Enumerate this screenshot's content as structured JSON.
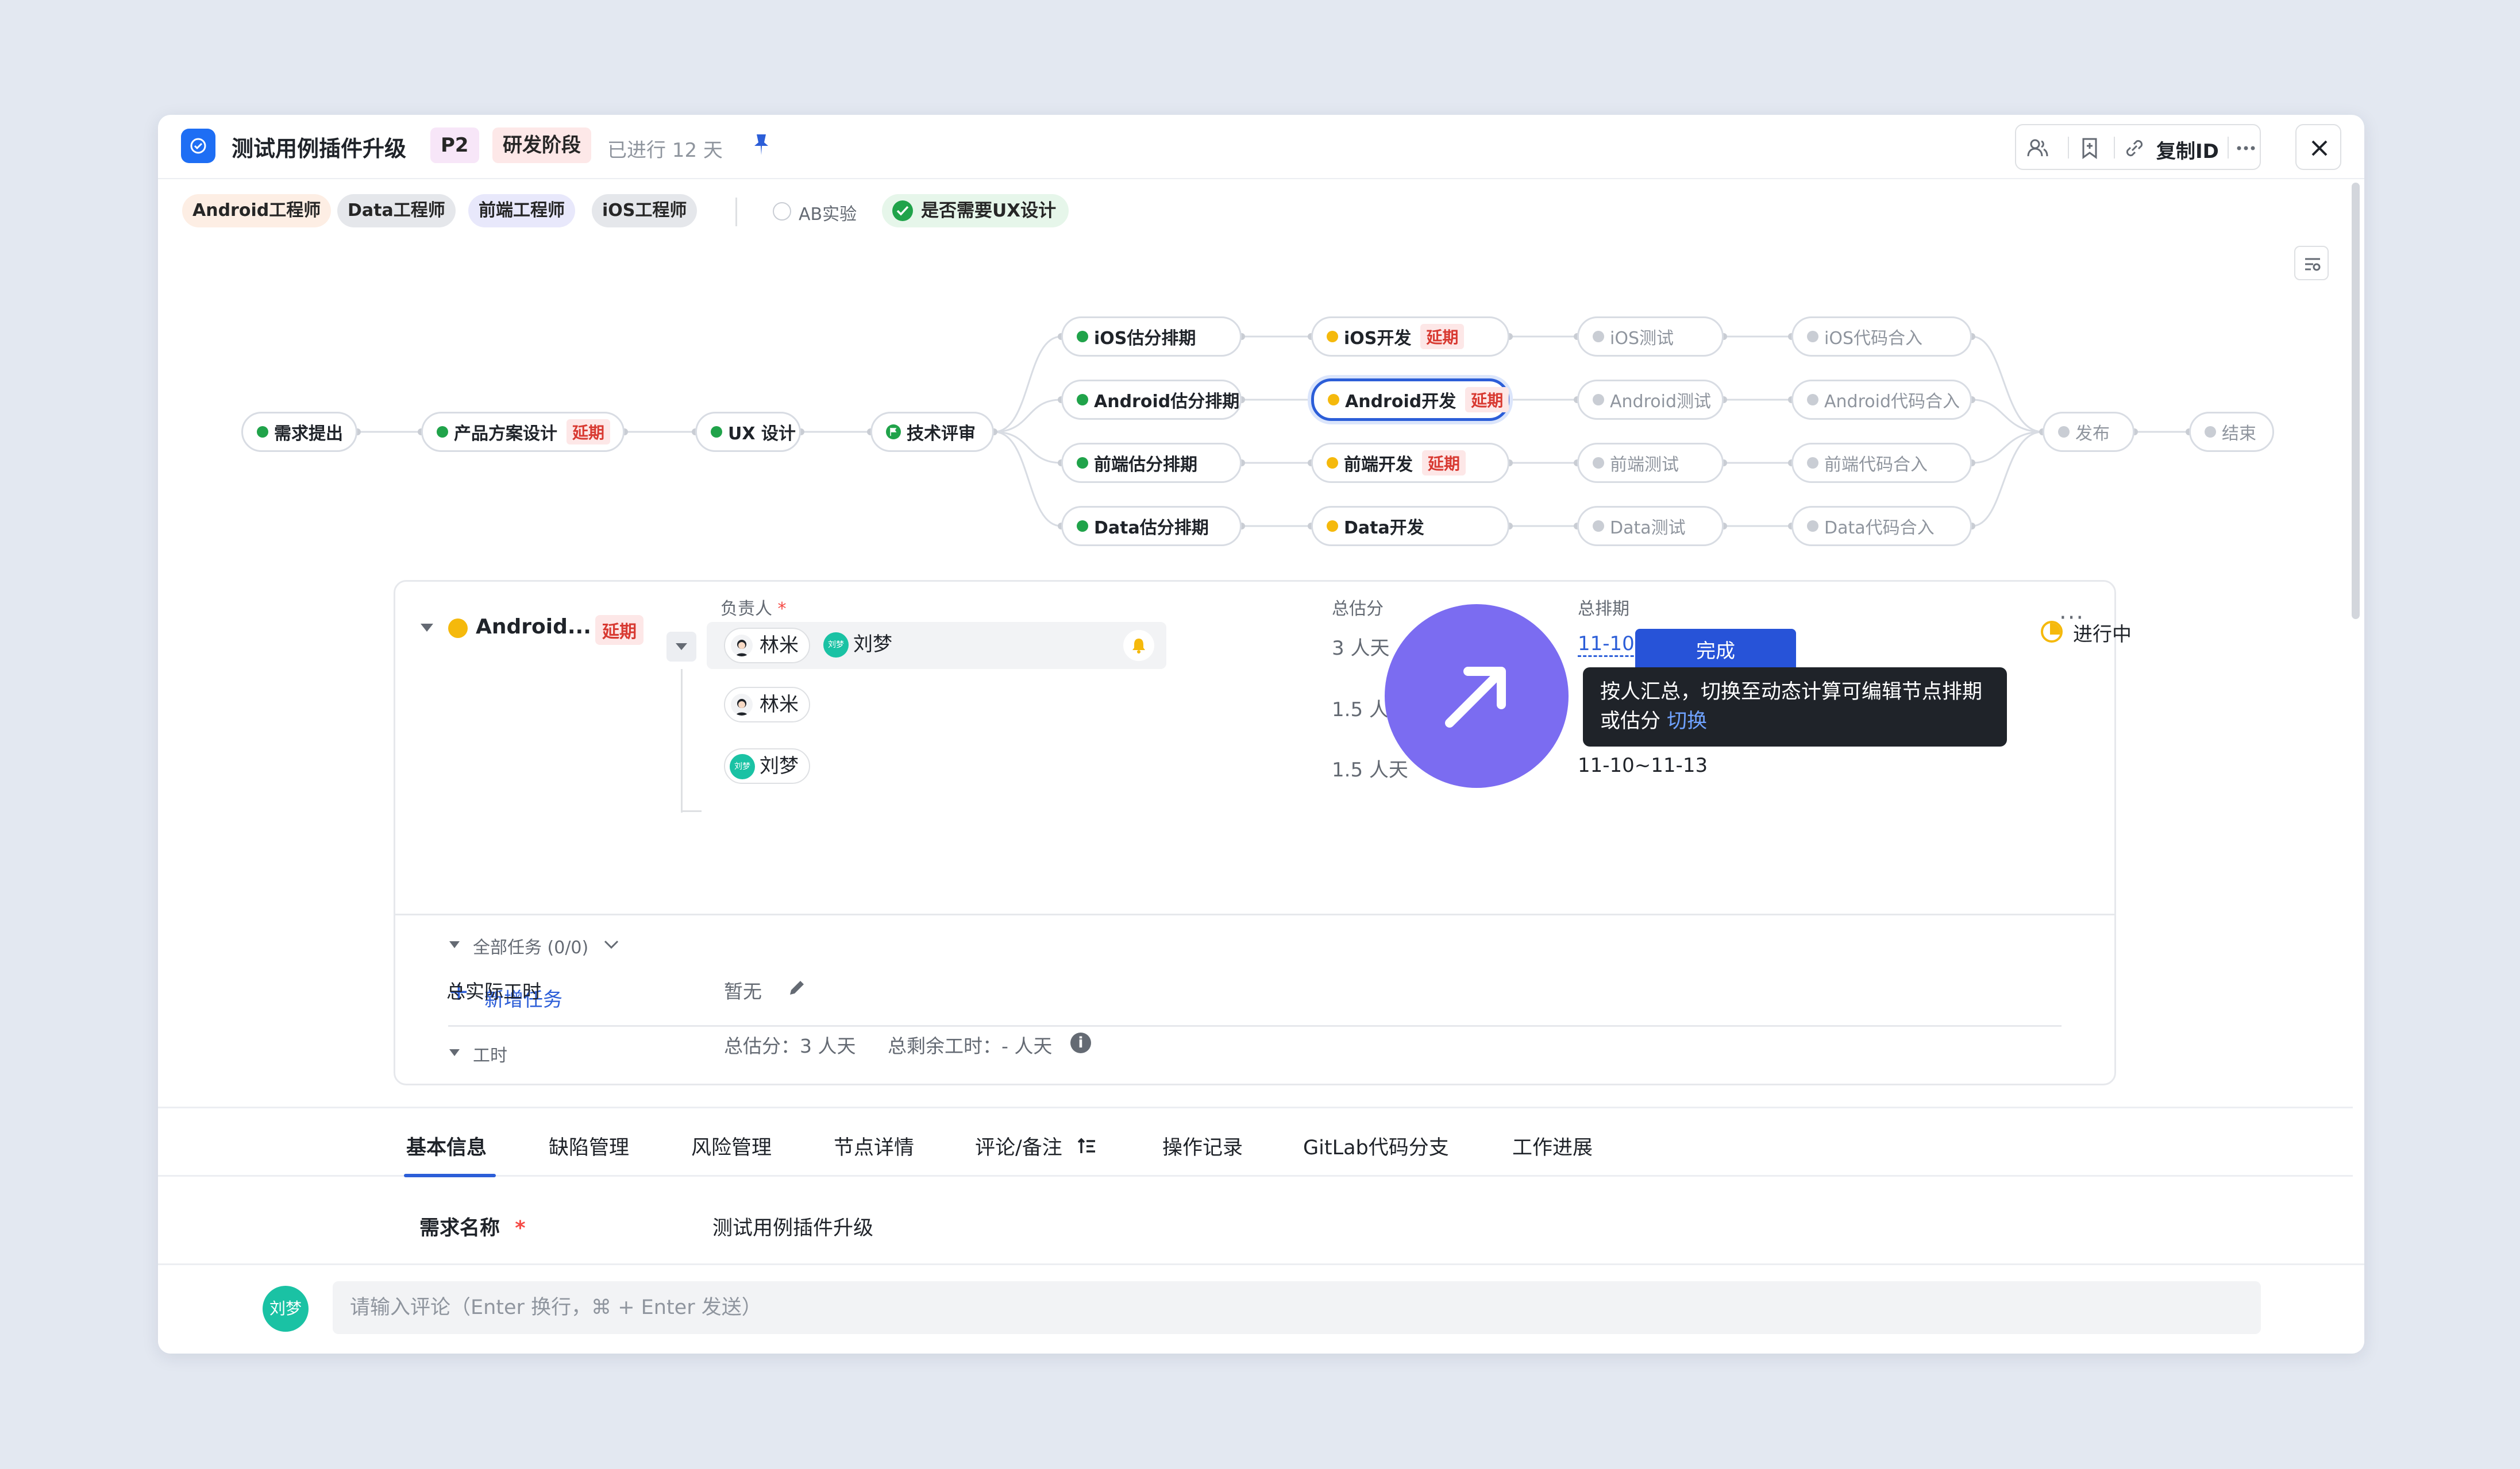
{
  "header": {
    "title": "测试用例插件升级",
    "priority": "P2",
    "stage": "研发阶段",
    "elapsed": "已进行 12 天",
    "copy_id_label": "复制ID"
  },
  "roles": [
    "Android工程师",
    "Data工程师",
    "前端工程师",
    "iOS工程师"
  ],
  "role_colors": [
    "#fdeee4",
    "#e5e7eb",
    "#e8e8fb",
    "#e5e7eb"
  ],
  "toggles": {
    "ab_label": "AB实验",
    "ux_label": "是否需要UX设计"
  },
  "flow": {
    "nodes": {
      "req": "需求提出",
      "product": "产品方案设计",
      "ux": "UX 设计",
      "review": "技术评审",
      "ios_est": "iOS估分排期",
      "android_est": "Android估分排期",
      "fe_est": "前端估分排期",
      "data_est": "Data估分排期",
      "ios_dev": "iOS开发",
      "android_dev": "Android开发",
      "fe_dev": "前端开发",
      "data_dev": "Data开发",
      "ios_test": "iOS测试",
      "android_test": "Android测试",
      "fe_test": "前端测试",
      "data_test": "Data测试",
      "ios_merge": "iOS代码合入",
      "android_merge": "Android代码合入",
      "fe_merge": "前端代码合入",
      "data_merge": "Data代码合入",
      "release": "发布",
      "end": "结束"
    },
    "delay_label": "延期"
  },
  "detail": {
    "node_name": "Android...",
    "delay_label": "延期",
    "col_owner": "负责人",
    "required_mark": "*",
    "col_estimate": "总估分",
    "col_schedule": "总排期",
    "owners": [
      "林米",
      "刘梦"
    ],
    "avatar_text": "刘梦",
    "total_estimate": "3 人天",
    "rows": [
      {
        "owner": "林米",
        "estimate": "1.5 人天",
        "schedule": ""
      },
      {
        "owner": "刘梦",
        "estimate": "1.5 人天",
        "schedule": "11-10~11-13"
      }
    ],
    "total_schedule": "11-10~11-13",
    "status": "进行中",
    "done_button": "完成",
    "all_tasks": "全部任务 (0/0)",
    "add_task": "新增任务",
    "work_hours": "工时",
    "actual_hours_label": "总实际工时",
    "actual_hours_value": "暂无",
    "summary_estimate": "总估分：3 人天",
    "summary_remaining": "总剩余工时：- 人天"
  },
  "tooltip": {
    "text": "按人汇总，切换至动态计算可编辑节点排期或估分",
    "link": "切换"
  },
  "tabs": [
    "基本信息",
    "缺陷管理",
    "风险管理",
    "节点详情",
    "评论/备注",
    "操作记录",
    "GitLab代码分支",
    "工作进展"
  ],
  "basic": {
    "name_label": "需求名称",
    "required_mark": "*",
    "name_value": "测试用例插件升级"
  },
  "comment": {
    "avatar_text": "刘梦",
    "placeholder": "请输入评论（Enter 换行，⌘ + Enter 发送）"
  }
}
